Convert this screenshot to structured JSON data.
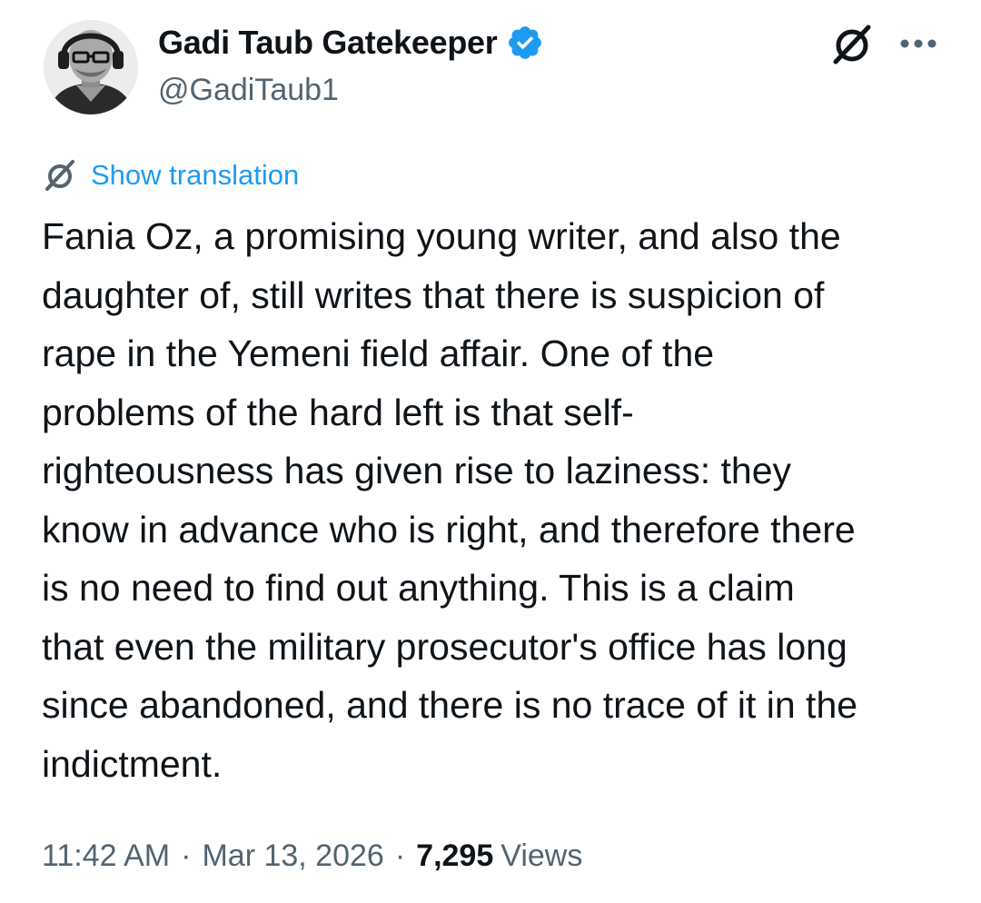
{
  "author": {
    "display_name": "Gadi Taub Gatekeeper",
    "handle": "@GadiTaub1",
    "verified_icon": "verified-badge-icon",
    "verified_color": "#1d9bf0"
  },
  "header_actions": {
    "grok_icon": "grok-icon",
    "more_icon": "more-horizontal-icon"
  },
  "translation": {
    "label": "Show translation",
    "icon": "grok-icon",
    "color": "#1d9bf0"
  },
  "tweet": {
    "text": "Fania Oz, a promising young writer, and also the\ndaughter of, still writes that there is suspicion of\nrape in the Yemeni field affair. One of the\nproblems of the hard left is that self-\nrighteousness has given rise to laziness: they\nknow in advance who is right, and therefore there\nis no need to find out anything. This is a claim\nthat even the military prosecutor's office has long\nsince abandoned, and there is no trace of it in the\nindictment."
  },
  "meta": {
    "time": "11:42 AM",
    "separator": "·",
    "date": "Mar 13, 2026",
    "views_count": "7,295",
    "views_label": "Views"
  },
  "colors": {
    "text_primary": "#0f1419",
    "text_secondary": "#536471",
    "accent": "#1d9bf0",
    "background": "#ffffff"
  }
}
